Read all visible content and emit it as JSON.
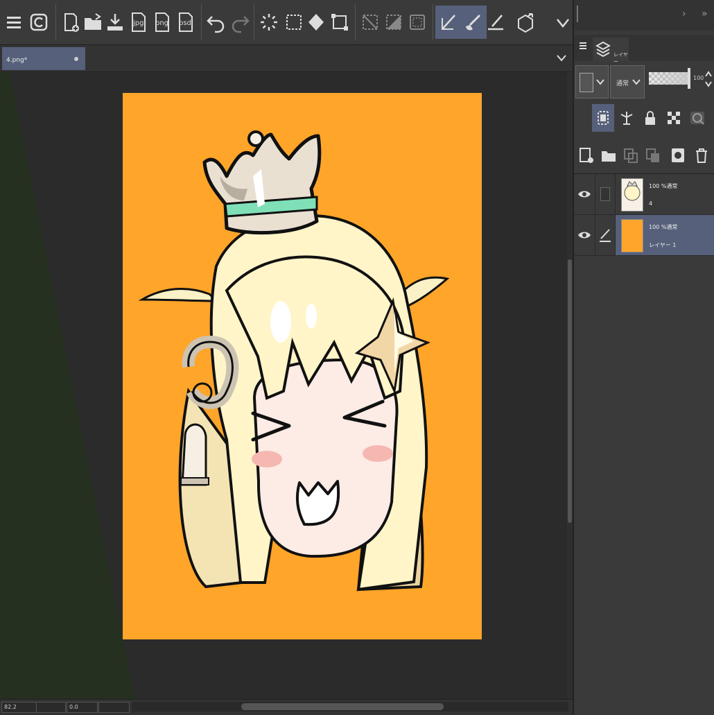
{
  "toolbar": {
    "jpg_label": "jpg",
    "png_label": "png",
    "psd_label": "psd"
  },
  "document_tab": {
    "name": "4.png*"
  },
  "layer_panel": {
    "tab_label": "レイヤー",
    "blend_mode": "通常",
    "opacity": "100"
  },
  "layers": [
    {
      "info": "100 %通常",
      "name": "4",
      "selected": false
    },
    {
      "info": "100 %通常",
      "name": "レイヤー 1",
      "selected": true
    }
  ],
  "status": {
    "zoom": "82.2",
    "angle": "0.0"
  },
  "colors": {
    "canvas_bg": "#ffa52a",
    "accent": "#56607a",
    "panel_bg": "#3a3a3a"
  }
}
